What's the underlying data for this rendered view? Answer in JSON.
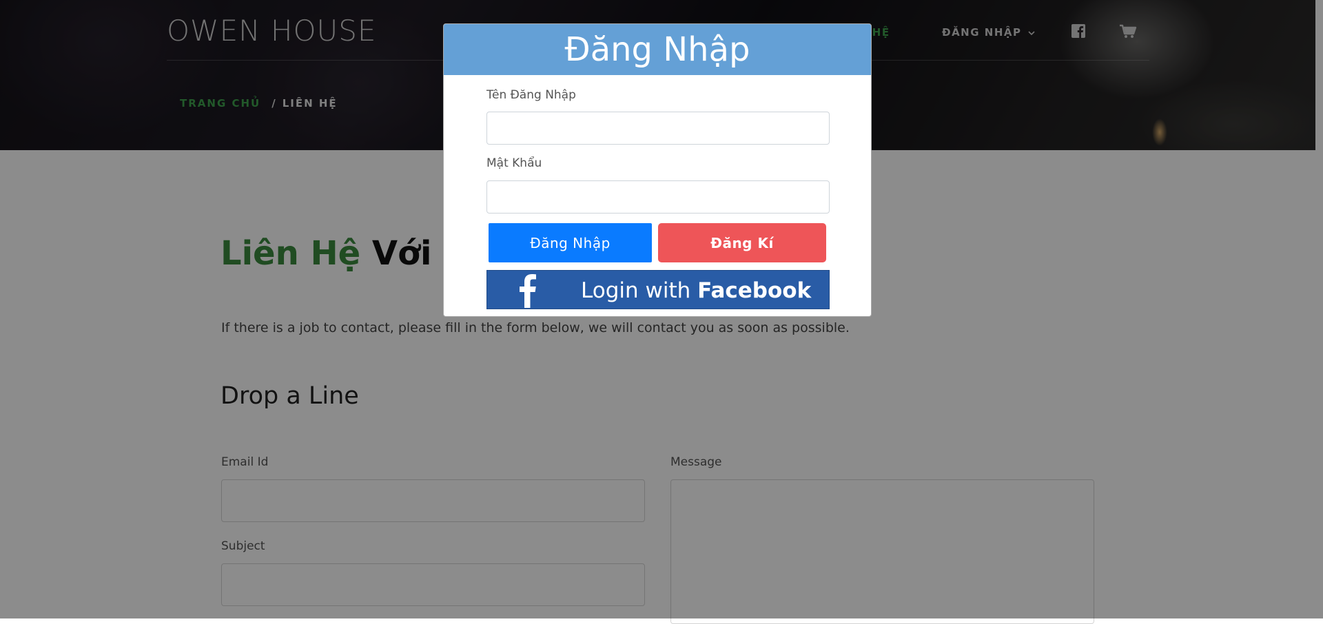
{
  "header": {
    "brand": "OWEN HOUSE",
    "nav": {
      "contact_partial": "N HỆ",
      "login": "ĐĂNG NHẬP"
    },
    "icons": [
      "facebook-icon",
      "cart-icon"
    ]
  },
  "breadcrumb": {
    "home": "TRANG CHỦ",
    "separator": "/",
    "current": "LIÊN HỆ"
  },
  "main": {
    "title_green": "Liên Hệ",
    "title_dark": "Với Ch",
    "intro": "If there is a job to contact, please fill in the form below, we will contact you as soon as possible.",
    "section_title": "Drop a Line",
    "fields": {
      "email_label": "Email Id",
      "subject_label": "Subject",
      "message_label": "Message"
    }
  },
  "modal": {
    "title": "Đăng Nhập",
    "username_label": "Tên Đăng Nhập",
    "username_value": "",
    "password_label": "Mật Khẩu",
    "password_value": "",
    "login_button": "Đăng Nhập",
    "register_button": "Đăng Kí",
    "facebook_prefix": "Login with ",
    "facebook_brand": "Facebook"
  },
  "colors": {
    "accent_green": "#3fa34d",
    "modal_header": "#64a0d6",
    "login_blue": "#0a7bff",
    "register_red": "#ee5558",
    "facebook_blue": "#295ca6"
  }
}
